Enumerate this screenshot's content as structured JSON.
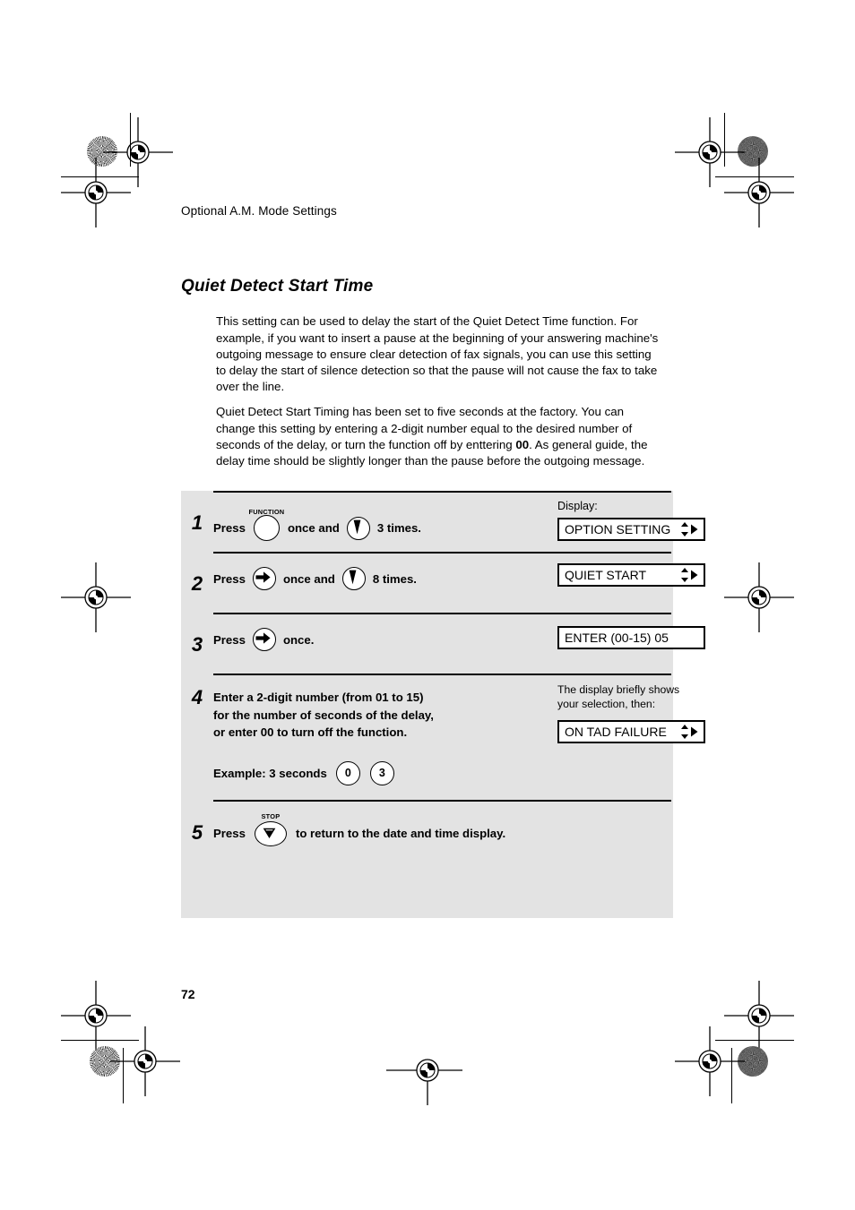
{
  "page": {
    "running_head": "Optional A.M. Mode Settings",
    "section_title": "Quiet Detect Start Time",
    "page_number": "72",
    "paragraphs": [
      "This setting can be used to delay the start of the Quiet Detect Time function. For example, if you want to insert a pause at the beginning of your answering machine's outgoing message to ensure clear detection of fax signals, you can use this setting to delay the start of silence detection so that the pause will not cause the fax to take over the line."
    ],
    "paragraph2": {
      "before_bold": "Quiet Detect Start Timing has been set to five seconds at the factory. You can change this setting by entering a 2-digit number equal to the desired number of seconds of the delay, or turn the function off by enttering ",
      "bold": "00",
      "after_bold": ". As general guide, the delay time should be slightly longer than the pause before the outgoing message."
    }
  },
  "procedure": {
    "display_caption": "Display:",
    "steps": [
      {
        "number": "1",
        "text_before": "Press",
        "key1_label": "FUNCTION",
        "key1_icon": "blank-round-key",
        "text_middle": "once and",
        "key2_icon": "down-arrow-key",
        "text_after": "3 times.",
        "display_text": "OPTION SETTING",
        "display_arrows": "updown-right"
      },
      {
        "number": "2",
        "text_before": "Press",
        "key1_label": "",
        "key1_icon": "start-key",
        "text_middle": "once and",
        "key2_icon": "down-arrow-key",
        "text_after": "8 times.",
        "display_text": "QUIET START",
        "display_arrows": "updown-right"
      },
      {
        "number": "3",
        "text_before": "Press",
        "key1_label": "",
        "key1_icon": "start-key",
        "text_middle": "",
        "key2_icon": "",
        "text_after": "once.",
        "display_text": "ENTER (00-15) 05",
        "display_arrows": "none"
      }
    ],
    "step4": {
      "number": "4",
      "line1": "Enter a 2-digit number (from 01 to 15)",
      "line2": "for the number of seconds of the delay,",
      "line3": "or enter 00 to turn off the function.",
      "example_label": "Example: 3 seconds",
      "example_key1": "0",
      "example_key2": "3",
      "note_line1": "The display briefly shows",
      "note_line2": "your selection, then:",
      "display_text": "ON TAD FAILURE",
      "display_arrows": "updown-right"
    },
    "step5": {
      "number": "5",
      "text_before": "Press",
      "key_label": "STOP",
      "key_icon": "stop-key",
      "text_after": "to return to the date and time display."
    }
  },
  "colors": {
    "panel_background": "#e3e3e3",
    "ink": "#000000",
    "page_background": "#ffffff"
  }
}
